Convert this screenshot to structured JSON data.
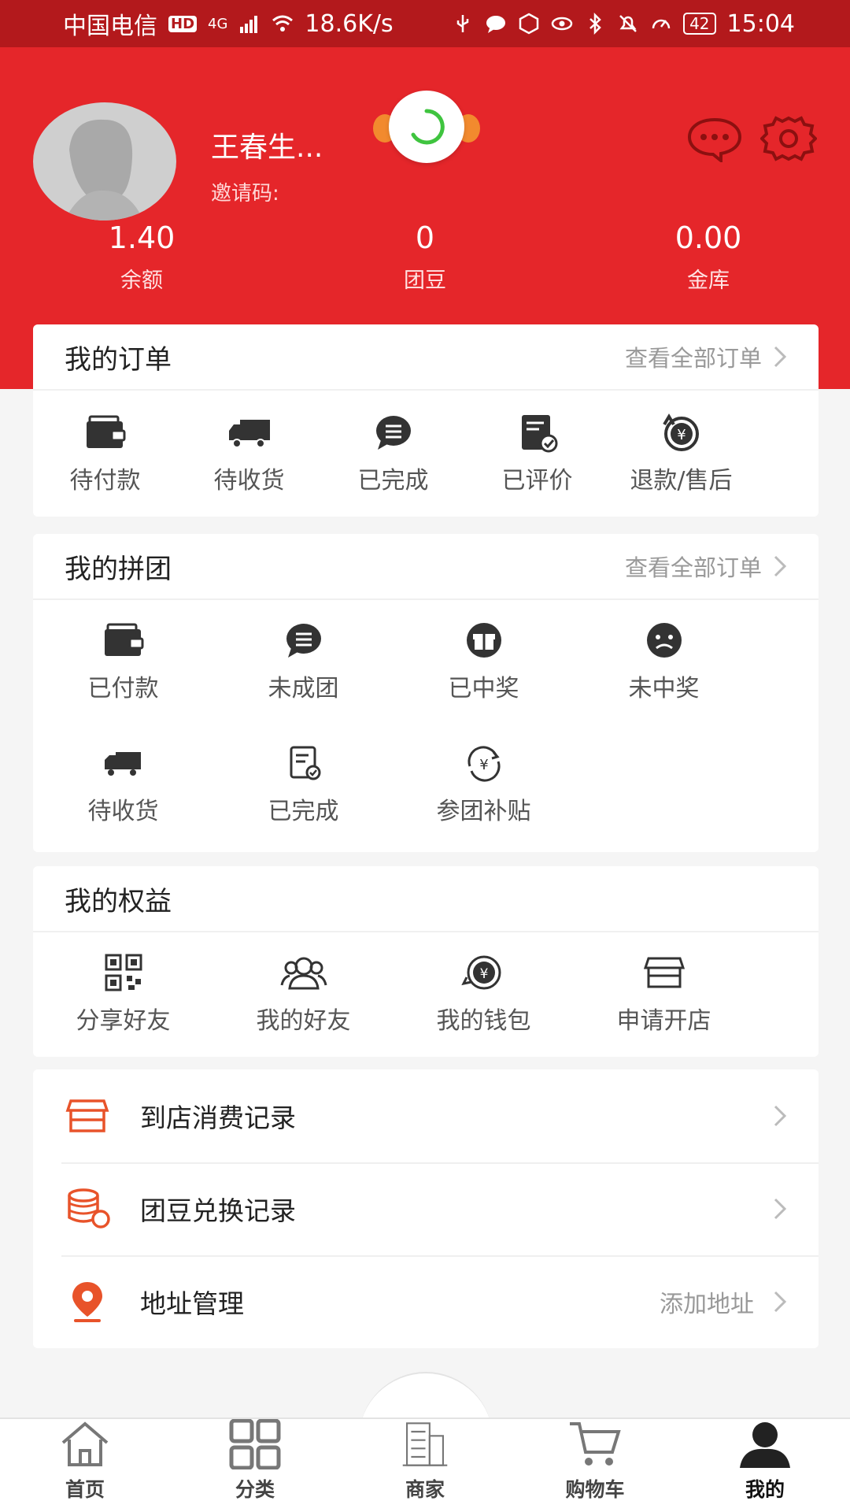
{
  "status_bar": {
    "carrier": "中国电信",
    "hd": "HD",
    "net": "4G",
    "speed": "18.6K/s",
    "battery": "42",
    "time": "15:04"
  },
  "profile": {
    "name": "王春生...",
    "invite_label": "邀请码:"
  },
  "stats": [
    {
      "value": "1.40",
      "label": "余额"
    },
    {
      "value": "0",
      "label": "团豆"
    },
    {
      "value": "0.00",
      "label": "金库"
    }
  ],
  "orders": {
    "title": "我的订单",
    "link": "查看全部订单",
    "items": [
      {
        "label": "待付款",
        "icon": "wallet-icon"
      },
      {
        "label": "待收货",
        "icon": "truck-icon"
      },
      {
        "label": "已完成",
        "icon": "chat-bubble-icon"
      },
      {
        "label": "已评价",
        "icon": "review-doc-icon"
      },
      {
        "label": "退款/售后",
        "icon": "refund-icon"
      }
    ]
  },
  "group": {
    "title": "我的拼团",
    "link": "查看全部订单",
    "items": [
      {
        "label": "已付款",
        "icon": "wallet-icon"
      },
      {
        "label": "未成团",
        "icon": "chat-bubble-icon"
      },
      {
        "label": "已中奖",
        "icon": "gift-icon"
      },
      {
        "label": "未中奖",
        "icon": "sad-face-icon"
      },
      {
        "label": "待收货",
        "icon": "truck-icon"
      },
      {
        "label": "已完成",
        "icon": "review-doc-icon"
      },
      {
        "label": "参团补贴",
        "icon": "yuan-refresh-icon"
      }
    ]
  },
  "rights": {
    "title": "我的权益",
    "items": [
      {
        "label": "分享好友",
        "icon": "qr-code-icon"
      },
      {
        "label": "我的好友",
        "icon": "friends-icon"
      },
      {
        "label": "我的钱包",
        "icon": "wallet-yuan-icon"
      },
      {
        "label": "申请开店",
        "icon": "store-icon"
      }
    ]
  },
  "list": [
    {
      "label": "到店消费记录",
      "icon": "store-icon",
      "right": ""
    },
    {
      "label": "团豆兑换记录",
      "icon": "coins-icon",
      "right": ""
    },
    {
      "label": "地址管理",
      "icon": "location-pin-icon",
      "right": "添加地址"
    }
  ],
  "nav": [
    {
      "label": "首页",
      "icon": "home-icon"
    },
    {
      "label": "分类",
      "icon": "category-grid-icon"
    },
    {
      "label": "商家",
      "icon": "building-icon"
    },
    {
      "label": "购物车",
      "icon": "cart-icon"
    },
    {
      "label": "我的",
      "icon": "user-icon"
    }
  ],
  "colors": {
    "header": "#e5262a",
    "status_bar": "#b3191c",
    "accent_orange": "#e8532a",
    "icon_dark": "#333333"
  }
}
